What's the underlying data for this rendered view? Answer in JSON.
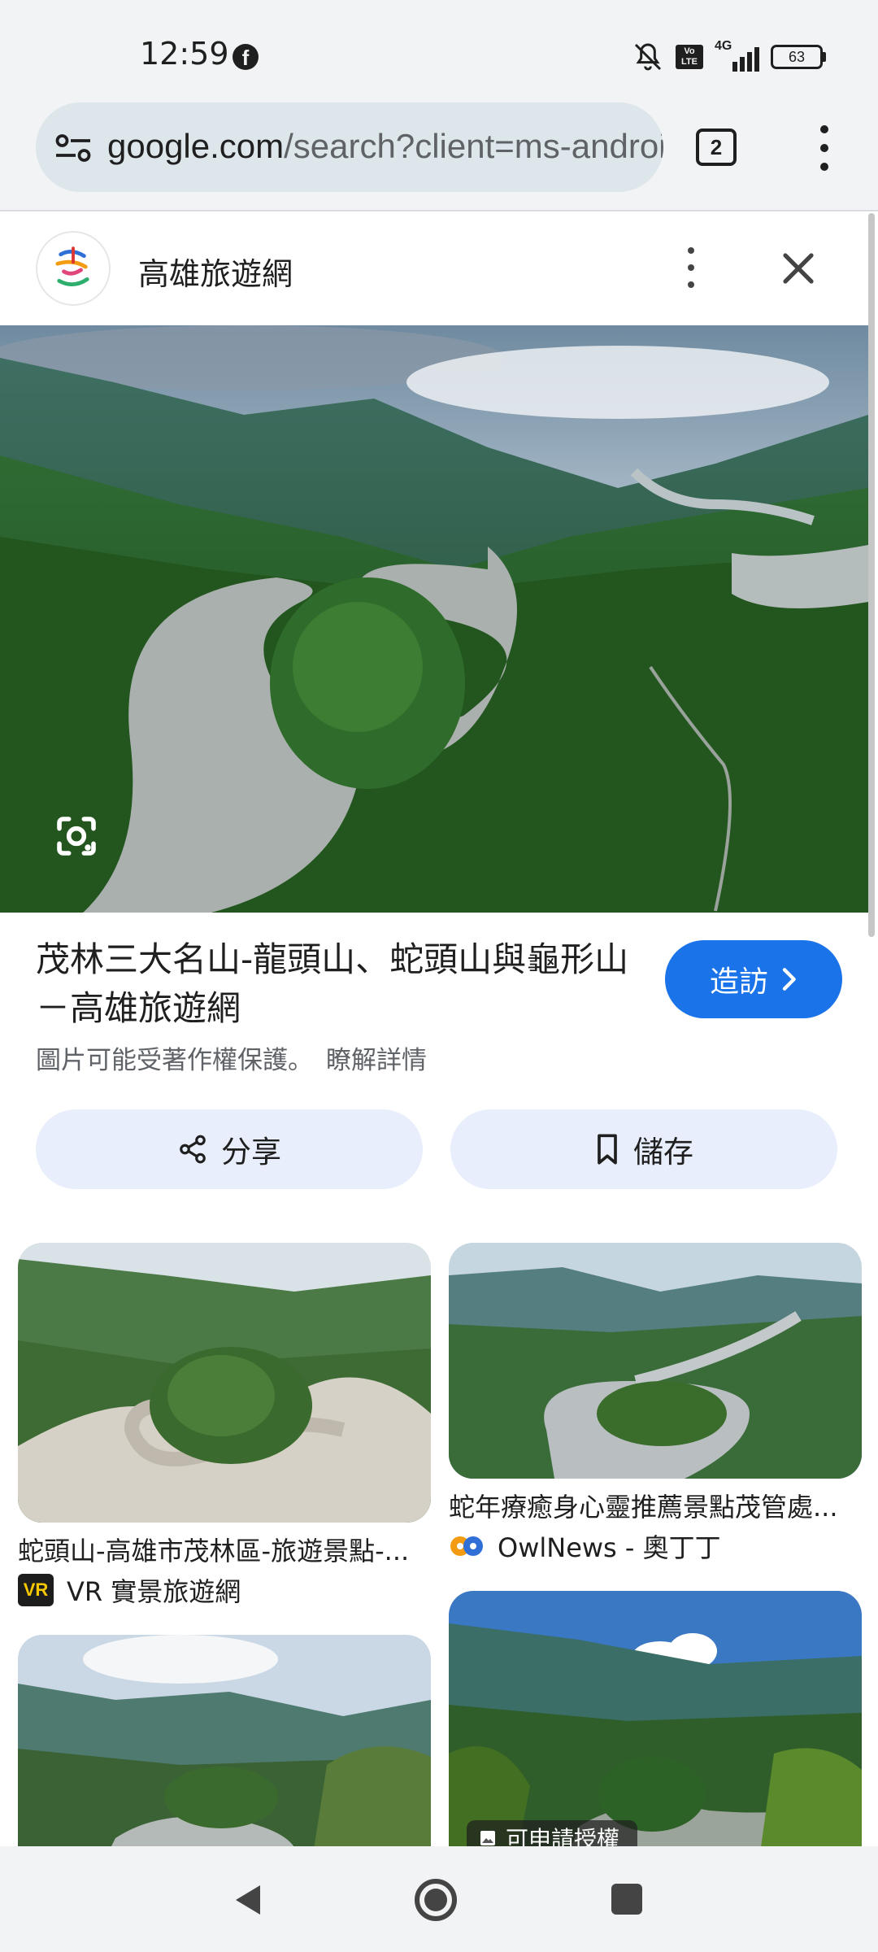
{
  "status_bar": {
    "time": "12:59",
    "notification_app": "f",
    "volte_label": "Vo LTE",
    "network": "4G",
    "battery": "63"
  },
  "browser": {
    "url_domain": "google.com",
    "url_path": "/search?client=ms-android",
    "tab_count": "2"
  },
  "source": {
    "name": "高雄旅遊網"
  },
  "result": {
    "title": "茂林三大名山-龍頭山、蛇頭山與龜形山－高雄旅遊網",
    "visit_label": "造訪",
    "copyright_text": "圖片可能受著作權保護。",
    "learn_more_label": "瞭解詳情"
  },
  "actions": {
    "share_label": "分享",
    "save_label": "儲存"
  },
  "related": [
    {
      "caption": "蛇頭山-高雄市茂林區-旅遊景點-...",
      "source": "VR 實景旅遊網",
      "source_icon": "VR"
    },
    {
      "caption": "蛇年療癒身心靈推薦景點茂管處...",
      "source": "OwlNews - 奧丁丁"
    },
    {
      "caption": ""
    },
    {
      "caption": "",
      "badge": "可申請授權"
    }
  ],
  "icons": [
    "facebook-icon",
    "mute-icon",
    "tune-icon",
    "more-vert-icon",
    "close-icon",
    "google-lens-icon",
    "share-icon",
    "bookmark-icon",
    "chevron-right-icon",
    "back-icon",
    "home-icon",
    "recents-icon"
  ],
  "colors": {
    "accent": "#1a73e8",
    "chip_bg": "#e8eefc",
    "surface": "#f1f3f4"
  }
}
